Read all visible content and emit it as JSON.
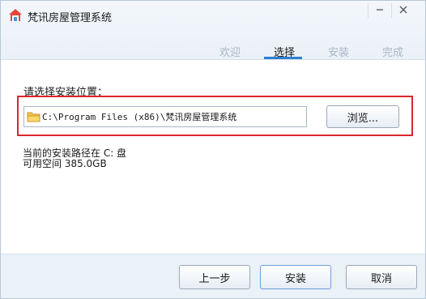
{
  "window": {
    "title": "梵讯房屋管理系统",
    "icon": "house-icon",
    "controls": {
      "minimize": "minimize-icon",
      "close": "close-icon"
    }
  },
  "steps": [
    {
      "label": "欢迎",
      "active": false
    },
    {
      "label": "选择",
      "active": true
    },
    {
      "label": "安装",
      "active": false
    },
    {
      "label": "完成",
      "active": false
    }
  ],
  "install_location": {
    "section_label": "请选择安装位置：",
    "path_value": "C:\\Program Files (x86)\\梵讯房屋管理系统",
    "folder_icon": "folder-icon",
    "browse_label": "浏览..."
  },
  "disk_info": {
    "drive_line": "当前的安装路径在 C: 盘",
    "space_line": "可用空间 385.0GB"
  },
  "footer": {
    "prev_label": "上一步",
    "install_label": "安装",
    "cancel_label": "取消"
  },
  "colors": {
    "accent": "#2f7fd0",
    "highlight": "#d9262d",
    "inactive_step": "#a9b7c4"
  }
}
